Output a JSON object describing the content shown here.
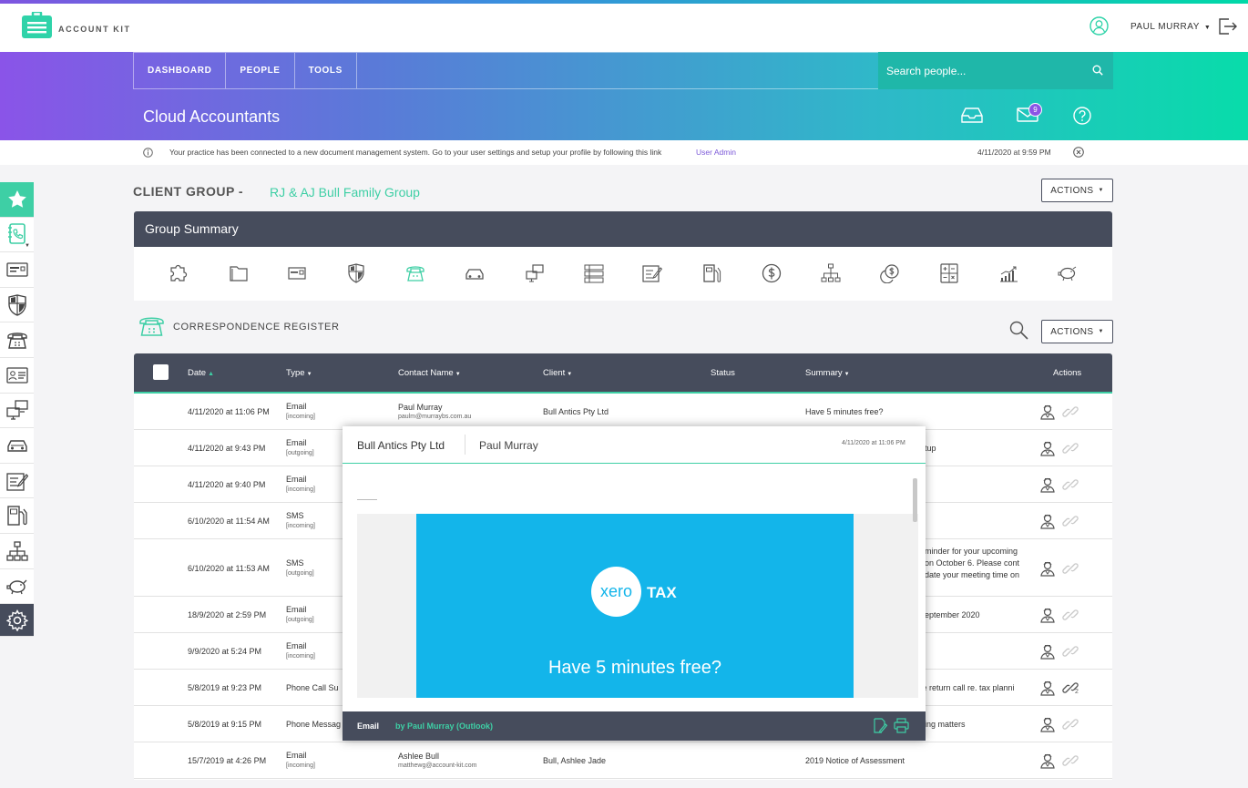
{
  "app": {
    "name": "ACCOUNT KIT",
    "user": "PAUL MURRAY",
    "icons": [
      "user-icon",
      "logout-icon"
    ]
  },
  "nav": {
    "items": [
      "DASHBOARD",
      "PEOPLE",
      "TOOLS"
    ],
    "search_placeholder": "Search people..."
  },
  "practice": {
    "name": "Cloud Accountants",
    "mail_count": "9"
  },
  "notice": {
    "text": "Your practice has been connected to a new document management system. Go to your user settings and setup your profile by following this link",
    "link": "User Admin",
    "timestamp": "4/11/2020 at 9:59 PM"
  },
  "client_group": {
    "label": "CLIENT GROUP -",
    "name": "RJ & AJ Bull Family Group",
    "actions_label": "ACTIONS"
  },
  "group_summary": {
    "title": "Group Summary",
    "icons": [
      "puzzle-icon",
      "folder-icon",
      "id-card-icon",
      "shield-icon",
      "telephone-icon",
      "car-icon",
      "computers-icon",
      "list-icon",
      "edit-form-icon",
      "fuel-icon",
      "dollar-icon",
      "org-chart-icon",
      "coins-icon",
      "calculator-icon",
      "bar-chart-icon",
      "piggy-bank-icon"
    ]
  },
  "sidebar": {
    "icons": [
      "star-icon",
      "contact-book-icon",
      "id-card-icon",
      "shield-icon",
      "telephone-icon",
      "profile-card-icon",
      "computers-icon",
      "car-icon",
      "edit-form-icon",
      "fuel-icon",
      "org-chart-icon",
      "piggy-bank-icon",
      "settings-icon"
    ]
  },
  "register": {
    "title": "CORRESPONDENCE REGISTER",
    "actions_label": "ACTIONS",
    "columns": {
      "date": "Date",
      "type": "Type",
      "contact": "Contact Name",
      "client": "Client",
      "status": "Status",
      "summary": "Summary",
      "actions": "Actions"
    },
    "rows": [
      {
        "date": "4/11/2020 at 11:06 PM",
        "type": "Email",
        "dir": "[incoming]",
        "contact": "Paul Murray",
        "contact_email": "paulm@murraybs.com.au",
        "client": "Bull Antics Pty Ltd",
        "summary": "Have 5 minutes free?"
      },
      {
        "date": "4/11/2020 at 9:43 PM",
        "type": "Email",
        "dir": "[outgoing]",
        "contact": "",
        "contact_email": "",
        "client": "",
        "summary": "tup"
      },
      {
        "date": "4/11/2020 at 9:40 PM",
        "type": "Email",
        "dir": "[incoming]",
        "contact": "",
        "contact_email": "",
        "client": "",
        "summary": ""
      },
      {
        "date": "6/10/2020 at 11:54 AM",
        "type": "SMS",
        "dir": "[incoming]",
        "contact": "",
        "contact_email": "",
        "client": "",
        "summary": ""
      },
      {
        "date": "6/10/2020 at 11:53 AM",
        "type": "SMS",
        "dir": "[outgoing]",
        "contact": "",
        "contact_email": "",
        "client": "",
        "summary_lines": [
          "minder for your upcoming",
          "on October 6. Please cont",
          "date your meeting time on"
        ]
      },
      {
        "date": "18/9/2020 at 2:59 PM",
        "type": "Email",
        "dir": "[outgoing]",
        "contact": "",
        "contact_email": "",
        "client": "",
        "summary": "eptember 2020"
      },
      {
        "date": "9/9/2020 at 5:24 PM",
        "type": "Email",
        "dir": "[incoming]",
        "contact": "",
        "contact_email": "",
        "client": "",
        "summary": ""
      },
      {
        "date": "5/8/2019 at 9:23 PM",
        "type": "Phone Call Su",
        "dir": "",
        "contact": "",
        "contact_email": "",
        "client": "",
        "summary": "se return call re. tax planni",
        "link_count": "2"
      },
      {
        "date": "5/8/2019 at 9:15 PM",
        "type": "Phone Messag",
        "dir": "",
        "contact": "",
        "contact_email": "",
        "client": "",
        "summary": "ing matters"
      },
      {
        "date": "15/7/2019 at 4:26 PM",
        "type": "Email",
        "dir": "[incoming]",
        "contact": "Ashlee Bull",
        "contact_email": "matthewg@account-kit.com",
        "client": "Bull, Ashlee Jade",
        "summary": "2019 Notice of Assessment"
      }
    ]
  },
  "popup": {
    "client": "Bull Antics Pty Ltd",
    "contact": "Paul Murray",
    "timestamp": "4/11/2020 at 11:06 PM",
    "xero_logo": "xero",
    "xero_tax": "TAX",
    "headline": "Have 5 minutes free?",
    "footer_type": "Email",
    "footer_by": "by Paul Murray (Outlook)"
  },
  "colors": {
    "accent": "#3ecfa5",
    "dark": "#464c5c",
    "purple": "#8b55e5",
    "xero_blue": "#13b5ea"
  }
}
